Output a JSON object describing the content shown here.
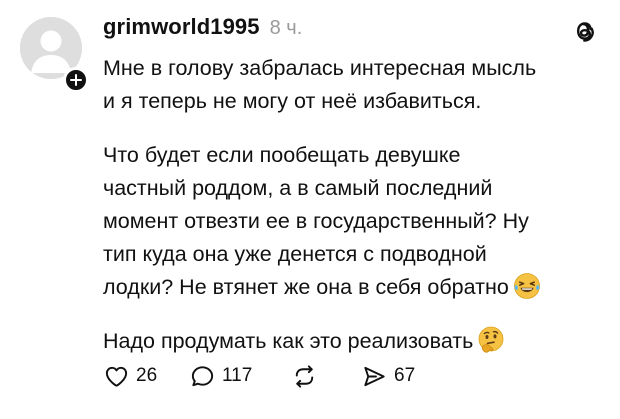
{
  "post": {
    "username": "grimworld1995",
    "time": "8 ч.",
    "paragraphs": [
      {
        "lines": [
          "Мне в голову забралась интересная мысль",
          "и я теперь не могу от неё избавиться."
        ]
      },
      {
        "lines": [
          "Что будет если пообещать девушке",
          "частный роддом, а в самый последний",
          "момент отвезти ее в государственный? Ну",
          "тип куда она уже денется с подводной",
          "лодки? Не втянет же она в себя обратно"
        ],
        "emoji": "laughing-emoji"
      },
      {
        "lines": [
          "Надо продумать как это реализовать"
        ],
        "emoji": "thinking-emoji"
      }
    ]
  },
  "actions": {
    "likes": "26",
    "replies": "117",
    "shares": "67"
  },
  "icons": {
    "avatar": "default-avatar-icon",
    "follow": "plus-icon",
    "app_logo": "threads-logo-icon",
    "like": "heart-icon",
    "reply": "comment-icon",
    "repost": "repost-icon",
    "share": "send-icon"
  },
  "colors": {
    "text": "#111111",
    "muted": "#9a9a9a",
    "avatar_bg": "#dedede",
    "avatar_fg": "#ffffff",
    "badge": "#111111",
    "emoji_yellow": "#f6c244"
  }
}
